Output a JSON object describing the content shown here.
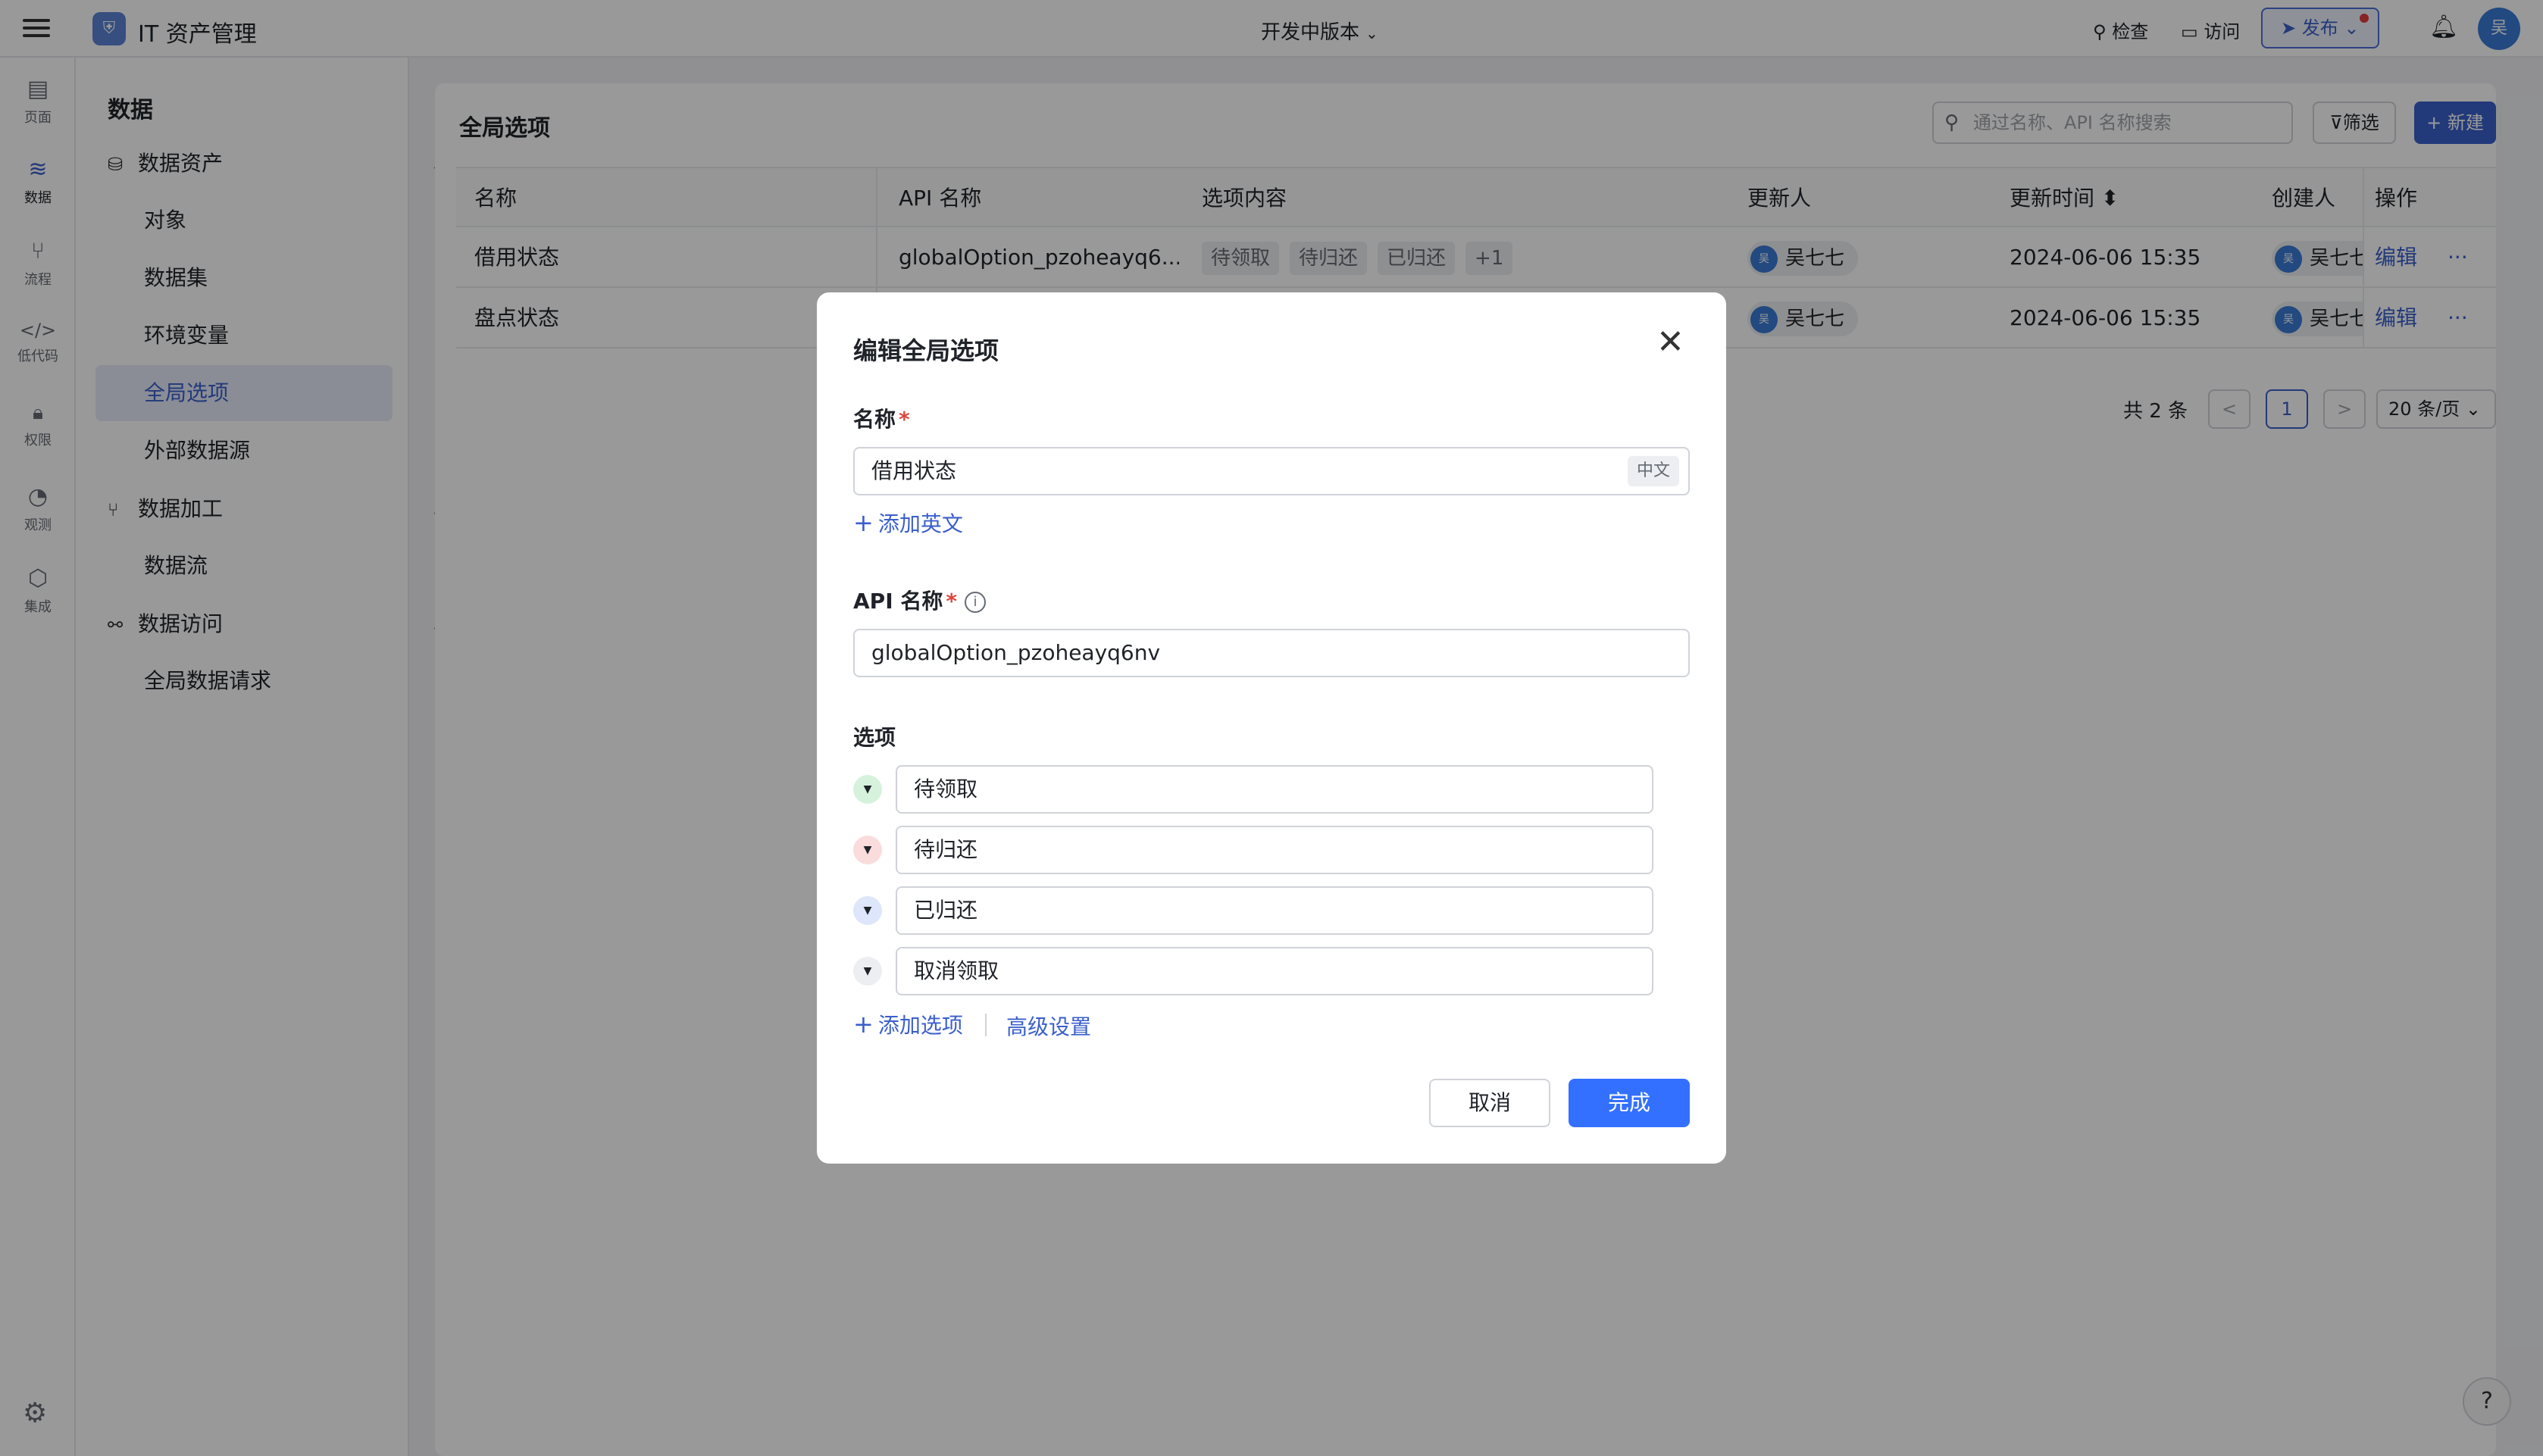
{
  "app": {
    "logo": "⛨",
    "title": "IT 资产管理",
    "version": "开发中版本"
  },
  "topbar": {
    "check": "检查",
    "visit": "访问",
    "publish": "发布",
    "avatar": "吴"
  },
  "rail": [
    {
      "label": "页面",
      "icon": "page-icon",
      "glyph": "▤"
    },
    {
      "label": "数据",
      "icon": "database-icon",
      "glyph": "≋"
    },
    {
      "label": "流程",
      "icon": "flow-icon",
      "glyph": "⑂"
    },
    {
      "label": "低代码",
      "icon": "code-icon",
      "glyph": "</>"
    },
    {
      "label": "权限",
      "icon": "lock-icon",
      "glyph": "🔒︎"
    },
    {
      "label": "观测",
      "icon": "monitor-icon",
      "glyph": "◔"
    },
    {
      "label": "集成",
      "icon": "cube-icon",
      "glyph": "⬡"
    }
  ],
  "sidebar": {
    "title": "数据",
    "groups": [
      {
        "label": "数据资产",
        "items": [
          "对象",
          "数据集",
          "环境变量",
          "全局选项",
          "外部数据源"
        ]
      },
      {
        "label": "数据加工",
        "items": [
          "数据流"
        ]
      },
      {
        "label": "数据访问",
        "items": [
          "全局数据请求"
        ]
      }
    ],
    "active_item": "全局选项"
  },
  "main": {
    "title": "全局选项",
    "search_placeholder": "通过名称、API 名称搜索",
    "filter_label": "筛选",
    "new_label": "+ 新建",
    "columns": [
      "名称",
      "API 名称",
      "选项内容",
      "更新人",
      "更新时间",
      "创建人",
      "操作"
    ],
    "sort_glyph": "⬍",
    "rows": [
      {
        "name": "借用状态",
        "api_name": "globalOption_pzoheayq6...",
        "options": [
          "待领取",
          "待归还",
          "已归还",
          "+1"
        ],
        "updater": "吴七七",
        "updated_at": "2024-06-06 15:35",
        "creator": "吴七七",
        "action": "编辑",
        "more": "···"
      },
      {
        "name": "盘点状态",
        "api_name": "",
        "options": [],
        "updater": "吴七七",
        "updated_at": "2024-06-06 15:35",
        "creator": "吴七七",
        "action": "编辑",
        "more": "···"
      }
    ],
    "pagination": {
      "total": "共 2 条",
      "prev": "<",
      "page": "1",
      "next": ">",
      "page_size": "20 条/页"
    }
  },
  "modal": {
    "title": "编辑全局选项",
    "close": "✕",
    "name_label": "名称",
    "name_value": "借用状态",
    "name_lang": "中文",
    "add_english": "添加英文",
    "api_label": "API 名称",
    "api_value": "globalOption_pzoheayq6nv",
    "options_label": "选项",
    "options": [
      {
        "label": "待领取",
        "color": "#d6f2dc"
      },
      {
        "label": "待归还",
        "color": "#fbdcdc"
      },
      {
        "label": "已归还",
        "color": "#dde6fb"
      },
      {
        "label": "取消领取",
        "color": "#eceef1"
      }
    ],
    "add_option": "添加选项",
    "advanced": "高级设置",
    "cancel": "取消",
    "done": "完成"
  },
  "help": "?"
}
